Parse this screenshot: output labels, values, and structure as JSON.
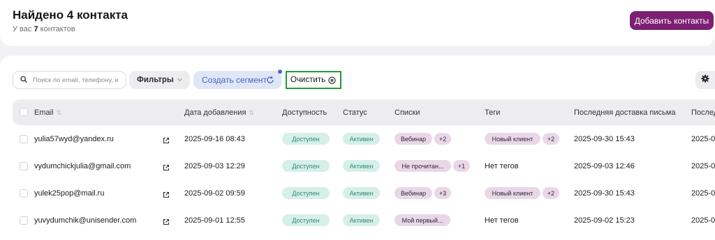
{
  "header": {
    "title": "Найдено 4 контакта",
    "sub_prefix": "У вас ",
    "sub_count": "7",
    "sub_suffix": " контактов",
    "add_button": "Добавить контакты"
  },
  "toolbar": {
    "search_placeholder": "Поиск по email, телефону, и",
    "filters_label": "Фильтры",
    "segment_label": "Создать сегмент",
    "clear_label": "Очистить"
  },
  "columns": {
    "email": "Email",
    "date_added": "Дата добавления",
    "availability": "Доступность",
    "status": "Статус",
    "lists": "Списки",
    "tags": "Теги",
    "last_delivery": "Последняя доставка письма",
    "last_cut": "Послед"
  },
  "rows": [
    {
      "email": "yulia57wyd@yandex.ru",
      "date": "2025-09-16 08:43",
      "availability": "Доступен",
      "status": "Активен",
      "list": "Вебинар",
      "list_more": "+2",
      "tag": "Новый клиент",
      "tag_more": "+2",
      "last_delivery": "2025-09-30 15:43",
      "last_cut": "2025-0"
    },
    {
      "email": "vydumchickjulia@gmail.com",
      "date": "2025-09-03 12:29",
      "availability": "Доступен",
      "status": "Активен",
      "list": "Не прочитан...",
      "list_more": "+1",
      "tag": "Нет тегов",
      "tag_more": "",
      "last_delivery": "2025-09-03 12:46",
      "last_cut": "2025-0"
    },
    {
      "email": "yulek25pop@mail.ru",
      "date": "2025-09-02 09:59",
      "availability": "Доступен",
      "status": "Активен",
      "list": "Вебинар",
      "list_more": "+3",
      "tag": "Новый клиент",
      "tag_more": "+2",
      "last_delivery": "2025-09-30 15:43",
      "last_cut": "2025-0"
    },
    {
      "email": "yuvydumchik@unisender.com",
      "date": "2025-09-01 12:55",
      "availability": "Доступен",
      "status": "Активен",
      "list": "Мой первый...",
      "list_more": "",
      "tag": "Нет тегов",
      "tag_more": "",
      "last_delivery": "2025-09-02 15:23",
      "last_cut": "2025-0"
    }
  ],
  "colors": {
    "primary": "#7c1f72",
    "segment_text": "#4a63c9",
    "highlight_border": "#1f9a37",
    "green_pill_bg": "#d6efe8",
    "purple_pill_bg": "#e9d7e8"
  }
}
